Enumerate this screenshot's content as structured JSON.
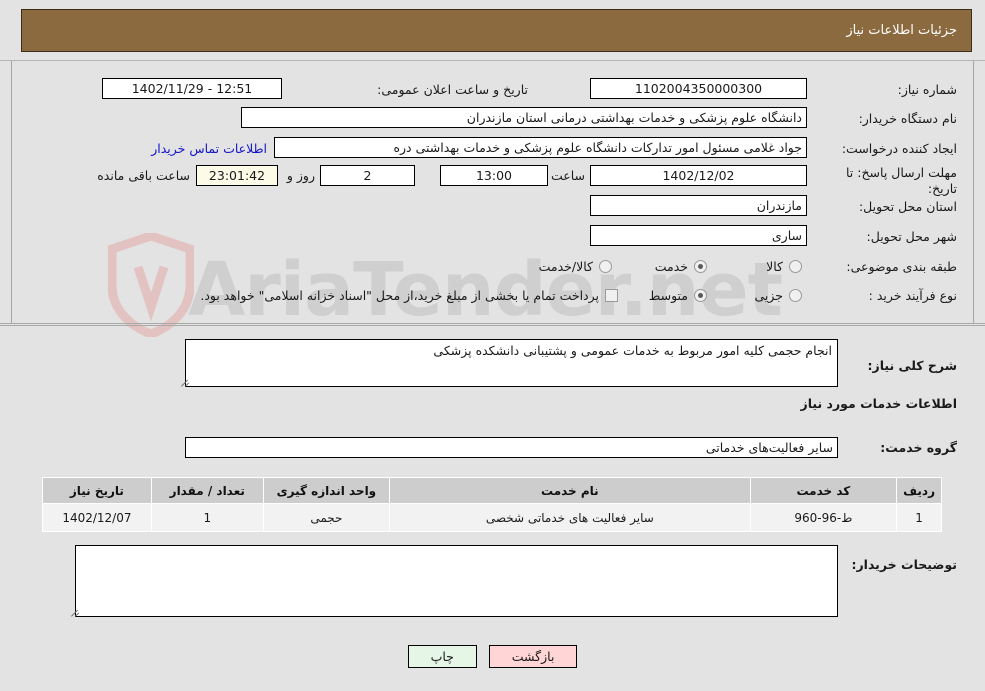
{
  "header": {
    "title": "جزئیات اطلاعات نیاز"
  },
  "watermark": {
    "text": "AriaTender.net",
    "shield_icon": "shield-icon"
  },
  "top_form": {
    "need_number_label": "شماره نیاز:",
    "need_number_value": "1102004350000300",
    "announce_datetime_label": "تاریخ و ساعت اعلان عمومی:",
    "announce_datetime_value": "12:51 - 1402/11/29",
    "buyer_org_label": "نام دستگاه خریدار:",
    "buyer_org_value": "دانشگاه علوم پزشکی و خدمات بهداشتی  درمانی استان مازندران",
    "creator_label": "ایجاد کننده درخواست:",
    "creator_value": "جواد غلامی مسئول امور تدارکات دانشگاه علوم پزشکی و خدمات بهداشتی  دره",
    "buyer_contact_link": "اطلاعات تماس خریدار",
    "deadline_label": "مهلت ارسال پاسخ: تا تاریخ:",
    "deadline_date": "1402/12/02",
    "hour_label": "ساعت",
    "deadline_time": "13:00",
    "remaining_days": "2",
    "days_and_label": "روز و",
    "remaining_time": "23:01:42",
    "remaining_suffix": "ساعت باقی مانده",
    "province_label": "استان محل تحویل:",
    "province_value": "مازندران",
    "city_label": "شهر محل تحویل:",
    "city_value": "ساری",
    "category_label": "طبقه بندی موضوعی:",
    "category_options": [
      {
        "label": "کالا",
        "selected": false
      },
      {
        "label": "خدمت",
        "selected": true
      },
      {
        "label": "کالا/خدمت",
        "selected": false
      }
    ],
    "process_label": "نوع فرآیند خرید :",
    "process_options": [
      {
        "label": "جزیی",
        "selected": false
      },
      {
        "label": "متوسط",
        "selected": true
      }
    ],
    "treasury_checkbox_label": "پرداخت تمام یا بخشی از مبلغ خرید،از محل \"اسناد خزانه اسلامی\" خواهد بود.",
    "treasury_checked": false
  },
  "description": {
    "label": "شرح کلی نیاز:",
    "value": "انجام حجمی کلیه امور مربوط به خدمات عمومی و پشتیبانی دانشکده پزشکی"
  },
  "services_section": {
    "title": "اطلاعات خدمات مورد نیاز",
    "group_label": "گروه خدمت:",
    "group_value": "سایر فعالیت‌های خدماتی",
    "table": {
      "columns": [
        "ردیف",
        "کد خدمت",
        "نام خدمت",
        "واحد اندازه گیری",
        "تعداد / مقدار",
        "تاریخ نیاز"
      ],
      "rows": [
        [
          "1",
          "ط-96-960",
          "سایر فعالیت های خدماتی شخصی",
          "حجمی",
          "1",
          "1402/12/07"
        ]
      ]
    }
  },
  "buyer_notes": {
    "label": "توضیحات خریدار:",
    "value": ""
  },
  "footer": {
    "back_label": "بازگشت",
    "print_label": "چاپ"
  },
  "colors": {
    "header_bg": "#8b6a3f",
    "page_bg": "#e3e3e3",
    "link": "#1414c8",
    "back_btn": "#ffd5d5",
    "print_btn": "#e6f6e6",
    "table_header": "#cdcdcd"
  }
}
